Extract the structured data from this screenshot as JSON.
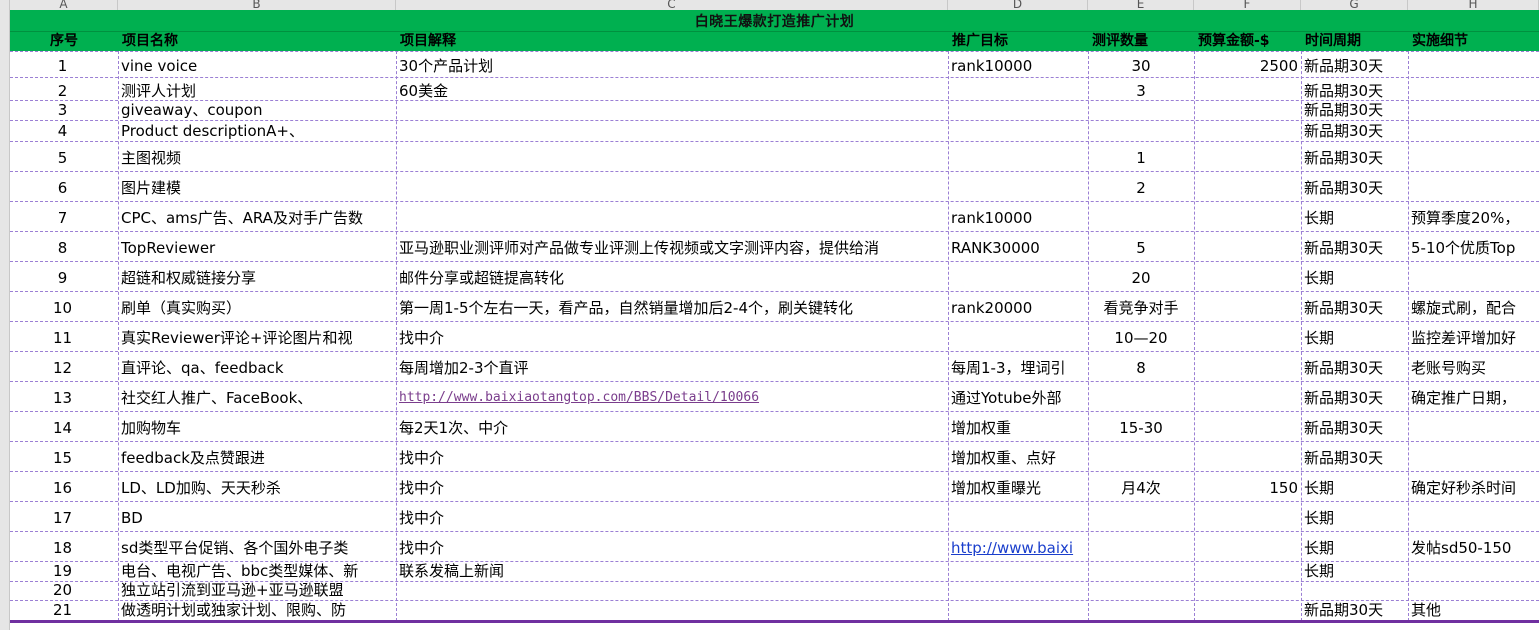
{
  "column_letters": [
    "A",
    "B",
    "C",
    "D",
    "E",
    "F",
    "G",
    "H"
  ],
  "title": "白晓王爆款打造推广计划",
  "headers": [
    "序号",
    "项目名称",
    "项目解释",
    "推广目标",
    "测评数量",
    "预算金额-$",
    "时间周期",
    "实施细节"
  ],
  "rows": [
    {
      "n": "1",
      "name": "vine voice",
      "desc": "30个产品计划",
      "goal": "rank10000",
      "qty": "30",
      "budget": "2500",
      "period": "新品期30天",
      "detail": ""
    },
    {
      "n": "2",
      "name": "测评人计划",
      "desc": "60美金",
      "goal": "",
      "qty": "3",
      "budget": "",
      "period": "新品期30天",
      "detail": ""
    },
    {
      "n": "3",
      "name": "giveaway、coupon",
      "desc": "",
      "goal": "",
      "qty": "",
      "budget": "",
      "period": "新品期30天",
      "detail": ""
    },
    {
      "n": "4",
      "name": "Product descriptionA+、",
      "desc": "",
      "goal": "",
      "qty": "",
      "budget": "",
      "period": "新品期30天",
      "detail": ""
    },
    {
      "n": "5",
      "name": "主图视频",
      "desc": "",
      "goal": "",
      "qty": "1",
      "budget": "",
      "period": "新品期30天",
      "detail": ""
    },
    {
      "n": "6",
      "name": "图片建模",
      "desc": "",
      "goal": "",
      "qty": "2",
      "budget": "",
      "period": "新品期30天",
      "detail": ""
    },
    {
      "n": "7",
      "name": "CPC、ams广告、ARA及对手广告数",
      "desc": "",
      "goal": "rank10000",
      "qty": "",
      "budget": "",
      "period": "长期",
      "detail": "预算季度20%，"
    },
    {
      "n": "8",
      "name": "TopReviewer",
      "desc": "亚马逊职业测评师对产品做专业评测上传视频或文字测评内容，提供给消",
      "goal": "RANK30000",
      "qty": "5",
      "budget": "",
      "period": "新品期30天",
      "detail": "5-10个优质Top"
    },
    {
      "n": "9",
      "name": "超链和权威链接分享",
      "desc": "邮件分享或超链提高转化",
      "goal": "",
      "qty": "20",
      "budget": "",
      "period": "长期",
      "detail": ""
    },
    {
      "n": "10",
      "name": "刷单（真实购买）",
      "desc": "第一周1-5个左右一天，看产品，自然销量增加后2-4个，刷关键转化",
      "goal": "rank20000",
      "qty": "看竞争对手",
      "budget": "",
      "period": "新品期30天",
      "detail": "螺旋式刷，配合"
    },
    {
      "n": "11",
      "name": "真实Reviewer评论+评论图片和视",
      "desc": "找中介",
      "goal": "",
      "qty": "10—20",
      "budget": "",
      "period": "长期",
      "detail": "监控差评增加好"
    },
    {
      "n": "12",
      "name": "直评论、qa、feedback",
      "desc": "每周增加2-3个直评",
      "goal": "每周1-3，埋词引",
      "qty": "8",
      "budget": "",
      "period": "新品期30天",
      "detail": "老账号购买"
    },
    {
      "n": "13",
      "name": "社交红人推广、FaceBook、",
      "desc": "http://www.baixiaotangtop.com/BBS/Detail/10066",
      "goal": "通过Yotube外部",
      "qty": "",
      "budget": "",
      "period": "新品期30天",
      "detail": "确定推广日期，"
    },
    {
      "n": "14",
      "name": "加购物车",
      "desc": "每2天1次、中介",
      "goal": "增加权重",
      "qty": "15-30",
      "budget": "",
      "period": "新品期30天",
      "detail": ""
    },
    {
      "n": "15",
      "name": "feedback及点赞跟进",
      "desc": "找中介",
      "goal": "增加权重、点好",
      "qty": "",
      "budget": "",
      "period": "新品期30天",
      "detail": ""
    },
    {
      "n": "16",
      "name": "LD、LD加购、天天秒杀",
      "desc": "找中介",
      "goal": "增加权重曝光",
      "qty": "月4次",
      "budget": "150",
      "period": "长期",
      "detail": "确定好秒杀时间"
    },
    {
      "n": "17",
      "name": "BD",
      "desc": "找中介",
      "goal": "",
      "qty": "",
      "budget": "",
      "period": "长期",
      "detail": ""
    },
    {
      "n": "18",
      "name": "sd类型平台促销、各个国外电子类",
      "desc": "找中介",
      "goal": "http://www.baixi",
      "qty": "",
      "budget": "",
      "period": "长期",
      "detail": "发帖sd50-150"
    },
    {
      "n": "19",
      "name": "电台、电视广告、bbc类型媒体、新",
      "desc": "联系发稿上新闻",
      "goal": "",
      "qty": "",
      "budget": "",
      "period": "长期",
      "detail": ""
    },
    {
      "n": "20",
      "name": "独立站引流到亚马逊+亚马逊联盟",
      "desc": "",
      "goal": "",
      "qty": "",
      "budget": "",
      "period": "",
      "detail": ""
    },
    {
      "n": "21",
      "name": "做透明计划或独家计划、限购、防",
      "desc": "",
      "goal": "",
      "qty": "",
      "budget": "",
      "period": "新品期30天",
      "detail": "其他"
    }
  ],
  "colors": {
    "header_green": "#00b050",
    "grid": "#9b7fd4",
    "bottom_border": "#7030a0",
    "link": "#1a3ecc",
    "visited": "#7a3d8c"
  }
}
